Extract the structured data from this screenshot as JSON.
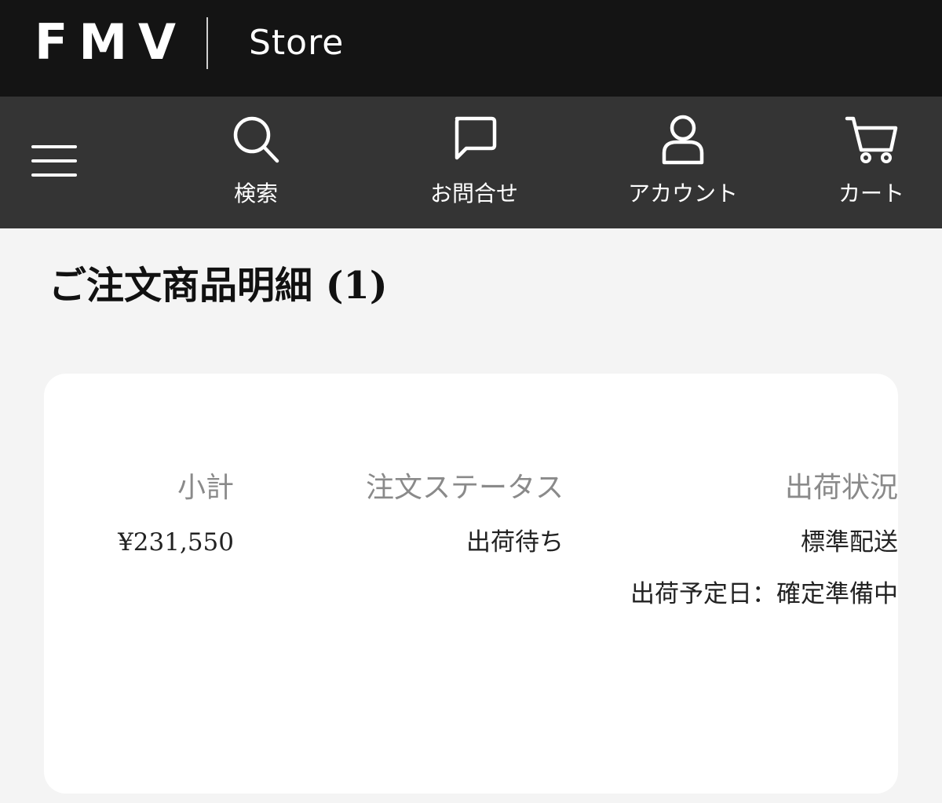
{
  "brand": {
    "logo": "FMV",
    "store": "Store"
  },
  "nav": {
    "menu_icon": "hamburger-menu-icon",
    "items": [
      {
        "label": "検索",
        "icon": "search-icon"
      },
      {
        "label": "お問合せ",
        "icon": "chat-bubble-icon"
      },
      {
        "label": "アカウント",
        "icon": "user-icon"
      },
      {
        "label": "カート",
        "icon": "cart-icon"
      }
    ]
  },
  "page": {
    "title": "ご注文商品明細 (1)"
  },
  "order": {
    "subtotal_label": "小計",
    "subtotal_value": "¥231,550",
    "status_label": "注文ステータス",
    "status_value": "出荷待ち",
    "shipping_label": "出荷状況",
    "shipping_method": "標準配送",
    "shipping_date": "出荷予定日：確定準備中"
  },
  "colors": {
    "brandbar_bg": "#141414",
    "navbar_bg": "#343434",
    "page_bg": "#f4f4f4",
    "card_bg": "#ffffff",
    "label_gray": "#8a8a8a"
  }
}
